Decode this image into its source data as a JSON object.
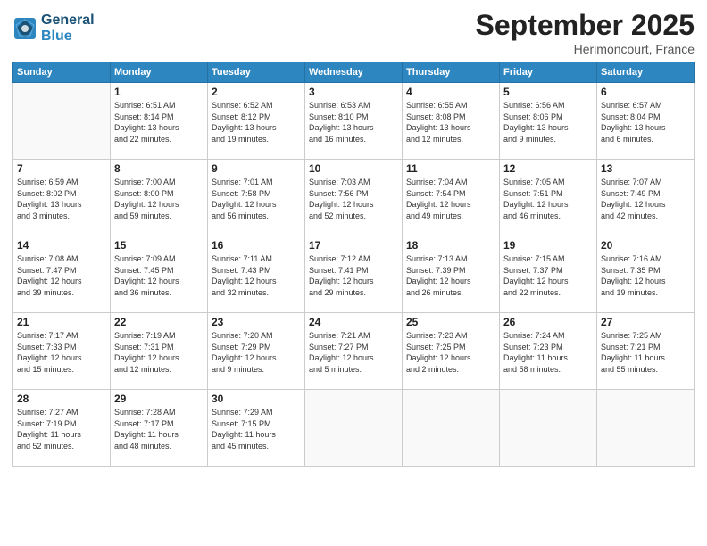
{
  "header": {
    "logo_line1": "General",
    "logo_line2": "Blue",
    "month": "September 2025",
    "location": "Herimoncourt, France"
  },
  "weekdays": [
    "Sunday",
    "Monday",
    "Tuesday",
    "Wednesday",
    "Thursday",
    "Friday",
    "Saturday"
  ],
  "weeks": [
    [
      {
        "day": "",
        "info": ""
      },
      {
        "day": "1",
        "info": "Sunrise: 6:51 AM\nSunset: 8:14 PM\nDaylight: 13 hours\nand 22 minutes."
      },
      {
        "day": "2",
        "info": "Sunrise: 6:52 AM\nSunset: 8:12 PM\nDaylight: 13 hours\nand 19 minutes."
      },
      {
        "day": "3",
        "info": "Sunrise: 6:53 AM\nSunset: 8:10 PM\nDaylight: 13 hours\nand 16 minutes."
      },
      {
        "day": "4",
        "info": "Sunrise: 6:55 AM\nSunset: 8:08 PM\nDaylight: 13 hours\nand 12 minutes."
      },
      {
        "day": "5",
        "info": "Sunrise: 6:56 AM\nSunset: 8:06 PM\nDaylight: 13 hours\nand 9 minutes."
      },
      {
        "day": "6",
        "info": "Sunrise: 6:57 AM\nSunset: 8:04 PM\nDaylight: 13 hours\nand 6 minutes."
      }
    ],
    [
      {
        "day": "7",
        "info": "Sunrise: 6:59 AM\nSunset: 8:02 PM\nDaylight: 13 hours\nand 3 minutes."
      },
      {
        "day": "8",
        "info": "Sunrise: 7:00 AM\nSunset: 8:00 PM\nDaylight: 12 hours\nand 59 minutes."
      },
      {
        "day": "9",
        "info": "Sunrise: 7:01 AM\nSunset: 7:58 PM\nDaylight: 12 hours\nand 56 minutes."
      },
      {
        "day": "10",
        "info": "Sunrise: 7:03 AM\nSunset: 7:56 PM\nDaylight: 12 hours\nand 52 minutes."
      },
      {
        "day": "11",
        "info": "Sunrise: 7:04 AM\nSunset: 7:54 PM\nDaylight: 12 hours\nand 49 minutes."
      },
      {
        "day": "12",
        "info": "Sunrise: 7:05 AM\nSunset: 7:51 PM\nDaylight: 12 hours\nand 46 minutes."
      },
      {
        "day": "13",
        "info": "Sunrise: 7:07 AM\nSunset: 7:49 PM\nDaylight: 12 hours\nand 42 minutes."
      }
    ],
    [
      {
        "day": "14",
        "info": "Sunrise: 7:08 AM\nSunset: 7:47 PM\nDaylight: 12 hours\nand 39 minutes."
      },
      {
        "day": "15",
        "info": "Sunrise: 7:09 AM\nSunset: 7:45 PM\nDaylight: 12 hours\nand 36 minutes."
      },
      {
        "day": "16",
        "info": "Sunrise: 7:11 AM\nSunset: 7:43 PM\nDaylight: 12 hours\nand 32 minutes."
      },
      {
        "day": "17",
        "info": "Sunrise: 7:12 AM\nSunset: 7:41 PM\nDaylight: 12 hours\nand 29 minutes."
      },
      {
        "day": "18",
        "info": "Sunrise: 7:13 AM\nSunset: 7:39 PM\nDaylight: 12 hours\nand 26 minutes."
      },
      {
        "day": "19",
        "info": "Sunrise: 7:15 AM\nSunset: 7:37 PM\nDaylight: 12 hours\nand 22 minutes."
      },
      {
        "day": "20",
        "info": "Sunrise: 7:16 AM\nSunset: 7:35 PM\nDaylight: 12 hours\nand 19 minutes."
      }
    ],
    [
      {
        "day": "21",
        "info": "Sunrise: 7:17 AM\nSunset: 7:33 PM\nDaylight: 12 hours\nand 15 minutes."
      },
      {
        "day": "22",
        "info": "Sunrise: 7:19 AM\nSunset: 7:31 PM\nDaylight: 12 hours\nand 12 minutes."
      },
      {
        "day": "23",
        "info": "Sunrise: 7:20 AM\nSunset: 7:29 PM\nDaylight: 12 hours\nand 9 minutes."
      },
      {
        "day": "24",
        "info": "Sunrise: 7:21 AM\nSunset: 7:27 PM\nDaylight: 12 hours\nand 5 minutes."
      },
      {
        "day": "25",
        "info": "Sunrise: 7:23 AM\nSunset: 7:25 PM\nDaylight: 12 hours\nand 2 minutes."
      },
      {
        "day": "26",
        "info": "Sunrise: 7:24 AM\nSunset: 7:23 PM\nDaylight: 11 hours\nand 58 minutes."
      },
      {
        "day": "27",
        "info": "Sunrise: 7:25 AM\nSunset: 7:21 PM\nDaylight: 11 hours\nand 55 minutes."
      }
    ],
    [
      {
        "day": "28",
        "info": "Sunrise: 7:27 AM\nSunset: 7:19 PM\nDaylight: 11 hours\nand 52 minutes."
      },
      {
        "day": "29",
        "info": "Sunrise: 7:28 AM\nSunset: 7:17 PM\nDaylight: 11 hours\nand 48 minutes."
      },
      {
        "day": "30",
        "info": "Sunrise: 7:29 AM\nSunset: 7:15 PM\nDaylight: 11 hours\nand 45 minutes."
      },
      {
        "day": "",
        "info": ""
      },
      {
        "day": "",
        "info": ""
      },
      {
        "day": "",
        "info": ""
      },
      {
        "day": "",
        "info": ""
      }
    ]
  ]
}
